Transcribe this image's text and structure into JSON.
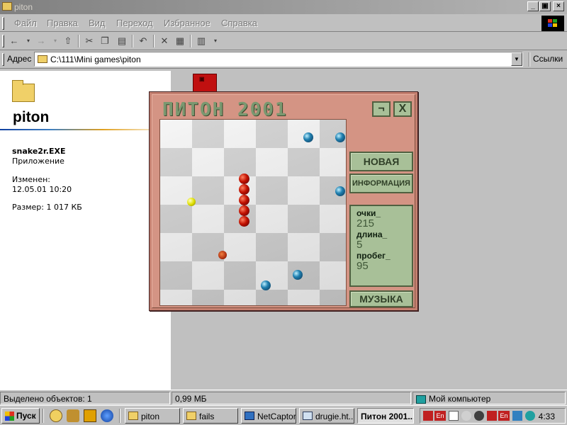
{
  "window": {
    "title": "piton"
  },
  "menu": {
    "items": [
      {
        "label": "Файл"
      },
      {
        "label": "Правка"
      },
      {
        "label": "Вид"
      },
      {
        "label": "Переход"
      },
      {
        "label": "Избранное"
      },
      {
        "label": "Справка"
      }
    ]
  },
  "address": {
    "label": "Адрес",
    "value": "C:\\111\\Mini games\\piton",
    "links_label": "Ссылки"
  },
  "left_pane": {
    "folder_name": "piton",
    "file_name": "snake2r.EXE",
    "file_type": "Приложение",
    "modified_label": "Изменен:",
    "modified_value": "12.05.01 10:20",
    "size_text": "Размер: 1 017 КБ"
  },
  "game": {
    "title": "ПИТОН 2001",
    "btn_min": "¬",
    "btn_close": "X",
    "btn_new": "НОВАЯ",
    "btn_info": "ИНФОРМАЦИЯ",
    "btn_music": "МУЗЫКА",
    "stats": {
      "score_label": "очки_",
      "score_value": "215",
      "length_label": "длина_",
      "length_value": "5",
      "run_label": "пробег_",
      "run_value": "95"
    }
  },
  "statusbar": {
    "selected": "Выделено объектов: 1",
    "size": "0,99 МБ",
    "location": "Мой компьютер"
  },
  "taskbar": {
    "start": "Пуск",
    "tasks": [
      {
        "label": "piton"
      },
      {
        "label": "fails"
      },
      {
        "label": "NetCaptor"
      },
      {
        "label": "drugie.ht..."
      },
      {
        "label": "Питон 2001..."
      }
    ],
    "lang1": "En",
    "lang2": "En",
    "clock": "4:33"
  },
  "colors": {
    "game_frame": "#c48070",
    "panel_green": "#a8c098",
    "desktop_gray": "#c0c0c0"
  }
}
